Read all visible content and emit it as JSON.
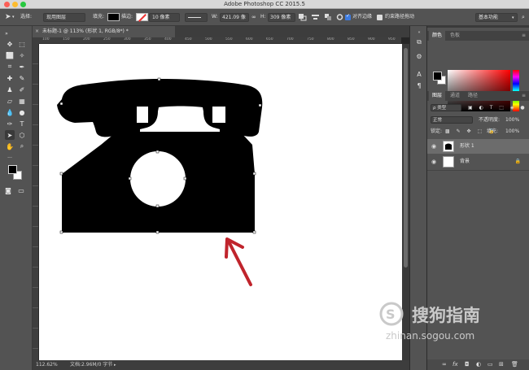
{
  "window": {
    "title": "Adobe Photoshop CC 2015.5"
  },
  "options_bar": {
    "select_label": "选择:",
    "select_value": "现用图层",
    "fill_label": "填充:",
    "stroke_label": "描边:",
    "stroke_width": "10 像素",
    "w_label": "W:",
    "w_value": "421.09 像",
    "h_label": "H:",
    "h_value": "309 像素",
    "align_edges_label": "对齐边缘",
    "constrain_path_label": "约束路径拖动",
    "workspace": "基本功能"
  },
  "document": {
    "tab_title": "未标题-1 @ 113% (形状 1, RGB/8*) *",
    "ruler_h": [
      "100",
      "150",
      "200",
      "250",
      "300",
      "350",
      "400",
      "450",
      "500",
      "550",
      "600",
      "650",
      "700",
      "750",
      "800",
      "850",
      "900",
      "950"
    ],
    "zoom": "112.62%",
    "doc_size": "文档:2.96M/0 字节"
  },
  "color_panel": {
    "tabs": [
      "颜色",
      "色板"
    ]
  },
  "layers_panel": {
    "tabs": [
      "图层",
      "通道",
      "路径"
    ],
    "filter_kind": "ρ 类型",
    "blend_mode": "正常",
    "opacity_label": "不透明度:",
    "opacity_value": "100%",
    "lock_label": "锁定:",
    "fill_label": "填充:",
    "fill_value": "100%",
    "layers": [
      {
        "name": "形状 1",
        "selected": true
      },
      {
        "name": "背景",
        "selected": false
      }
    ]
  },
  "watermark": {
    "brand": "搜狗指南",
    "url": "zhinan.sogou.com"
  },
  "colors": {
    "panel": "#535353",
    "dark": "#3d3d3d",
    "annotation_arrow": "#c0242c"
  }
}
